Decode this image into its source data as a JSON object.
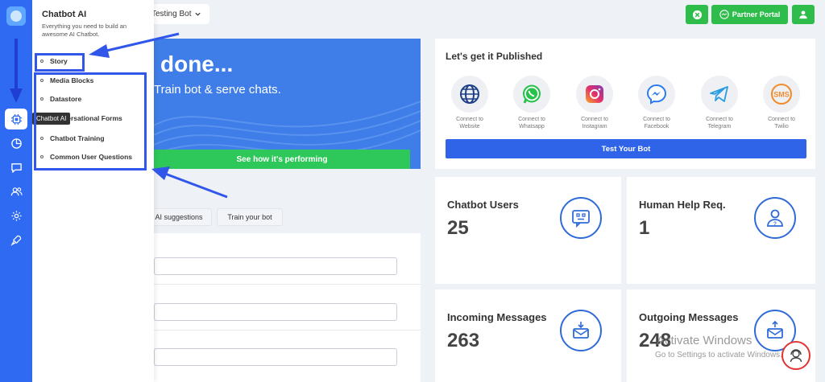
{
  "sidebar": {
    "tooltip": "Chatbot AI",
    "panel_title": "Chatbot AI",
    "panel_desc": "Everything you need to build an awesome AI Chatbot.",
    "items": [
      {
        "label": "Story"
      },
      {
        "label": "Media Blocks"
      },
      {
        "label": "Datastore"
      },
      {
        "label": "Conversational Forms"
      },
      {
        "label": "Chatbot Training"
      },
      {
        "label": "Common User Questions"
      }
    ]
  },
  "header": {
    "bot_name": "Testing Bot",
    "partner_label": "Partner Portal"
  },
  "hero": {
    "title": "done...",
    "subtitle": "Train bot & serve chats.",
    "cta": "See how it's performing"
  },
  "training": {
    "chips": [
      "AI suggestions",
      "Train your bot"
    ]
  },
  "publish": {
    "title": "Let's get it Published",
    "channels": [
      {
        "line1": "Connect to",
        "line2": "Website"
      },
      {
        "line1": "Connect to",
        "line2": "Whatsapp"
      },
      {
        "line1": "Connect to",
        "line2": "Instagram"
      },
      {
        "line1": "Connect to",
        "line2": "Facebook"
      },
      {
        "line1": "Connect to",
        "line2": "Telegram"
      },
      {
        "line1": "Connect to",
        "line2": "Twilio"
      }
    ],
    "sms_text": "SMS",
    "test_label": "Test Your Bot"
  },
  "stats": [
    {
      "title": "Chatbot Users",
      "value": "25"
    },
    {
      "title": "Human Help Req.",
      "value": "1"
    },
    {
      "title": "Incoming Messages",
      "value": "263"
    },
    {
      "title": "Outgoing Messages",
      "value": "248"
    }
  ],
  "watermark": {
    "line1": "Activate Windows",
    "line2": "Go to Settings to activate Windows."
  },
  "colors": {
    "rail": "#2f6bf2",
    "accent_green": "#2ebd4a",
    "hero_blue": "#3f7de8",
    "highlight": "#3056ea"
  }
}
